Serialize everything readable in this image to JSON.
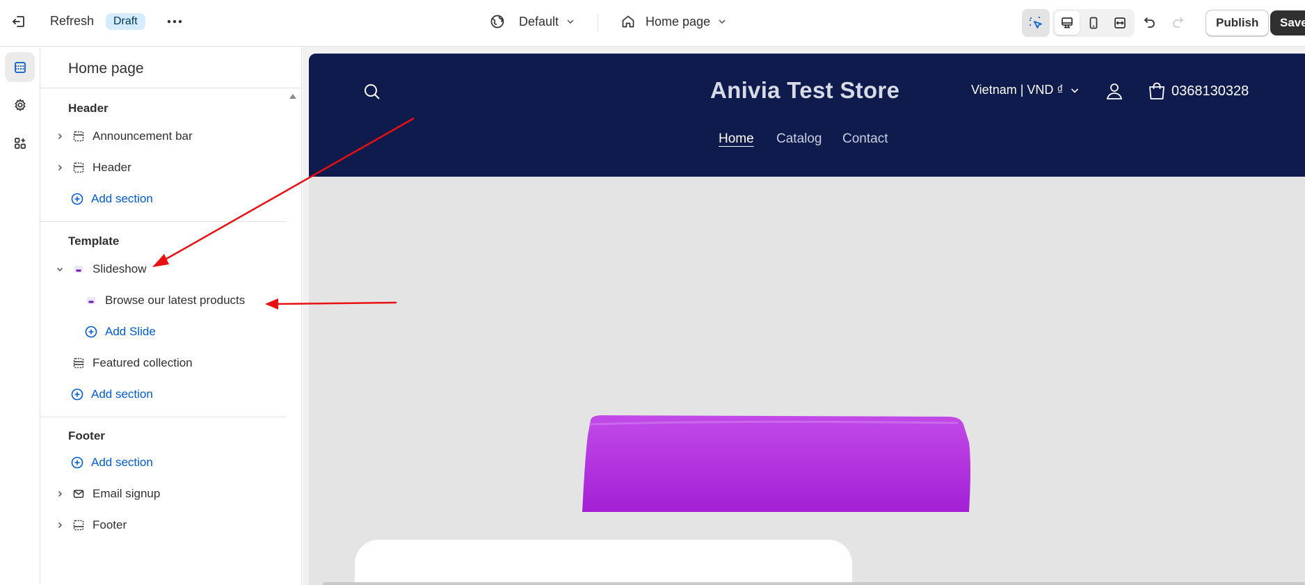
{
  "topbar": {
    "refresh_label": "Refresh",
    "status_badge": "Draft",
    "theme_selector": "Default",
    "page_selector": "Home page",
    "publish_label": "Publish",
    "save_label": "Save"
  },
  "rail": {
    "items": [
      {
        "icon": "sections-icon",
        "active": true
      },
      {
        "icon": "settings-icon",
        "active": false
      },
      {
        "icon": "apps-icon",
        "active": false
      }
    ]
  },
  "sidebar": {
    "title": "Home page",
    "header_group": {
      "heading": "Header",
      "items": [
        "Announcement bar",
        "Header"
      ],
      "add_label": "Add section"
    },
    "template_group": {
      "heading": "Template",
      "slideshow_label": "Slideshow",
      "slide_label": "Browse our latest products",
      "add_slide_label": "Add Slide",
      "featured_label": "Featured collection",
      "add_label": "Add section"
    },
    "footer_group": {
      "heading": "Footer",
      "add_label": "Add section",
      "items": [
        "Email signup",
        "Footer"
      ]
    }
  },
  "store": {
    "name": "Anivia Test Store",
    "locale": "Vietnam | VND ₫",
    "phone": "0368130328",
    "nav": [
      "Home",
      "Catalog",
      "Contact"
    ],
    "header_color": "#0f1b4c",
    "product_color": "#b02ee0"
  },
  "colors": {
    "accent_link": "#005bd3",
    "annotation_arrow": "#e81010"
  }
}
